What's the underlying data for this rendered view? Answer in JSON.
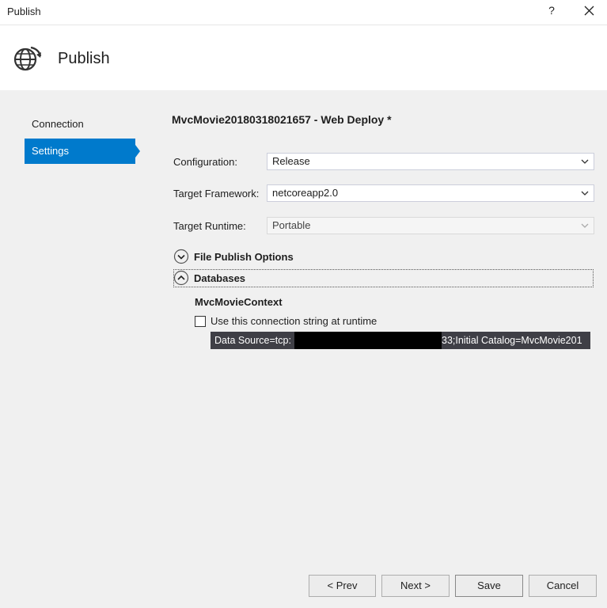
{
  "window": {
    "title": "Publish",
    "help_label": "?"
  },
  "header": {
    "title": "Publish",
    "icon": "publish-globe-icon"
  },
  "nav": {
    "items": [
      {
        "label": "Connection",
        "active": false
      },
      {
        "label": "Settings",
        "active": true
      }
    ]
  },
  "main": {
    "profile_title": "MvcMovie20180318021657 - Web Deploy *",
    "configuration": {
      "label": "Configuration:",
      "value": "Release"
    },
    "target_framework": {
      "label": "Target Framework:",
      "value": "netcoreapp2.0"
    },
    "target_runtime": {
      "label": "Target Runtime:",
      "value": "Portable"
    },
    "file_publish_options": {
      "label": "File Publish Options",
      "expanded": false
    },
    "databases": {
      "label": "Databases",
      "expanded": true,
      "context_name": "MvcMovieContext",
      "checkbox_label": "Use this connection string at runtime",
      "checkbox_checked": false,
      "connection_prefix": "Data Source=tcp:",
      "connection_suffix": "33;Initial Catalog=MvcMovie201"
    }
  },
  "footer": {
    "prev_label": "< Prev",
    "next_label": "Next >",
    "save_label": "Save",
    "cancel_label": "Cancel"
  },
  "colors": {
    "accent": "#007acc",
    "tooltip_bg": "#3f3f46"
  }
}
